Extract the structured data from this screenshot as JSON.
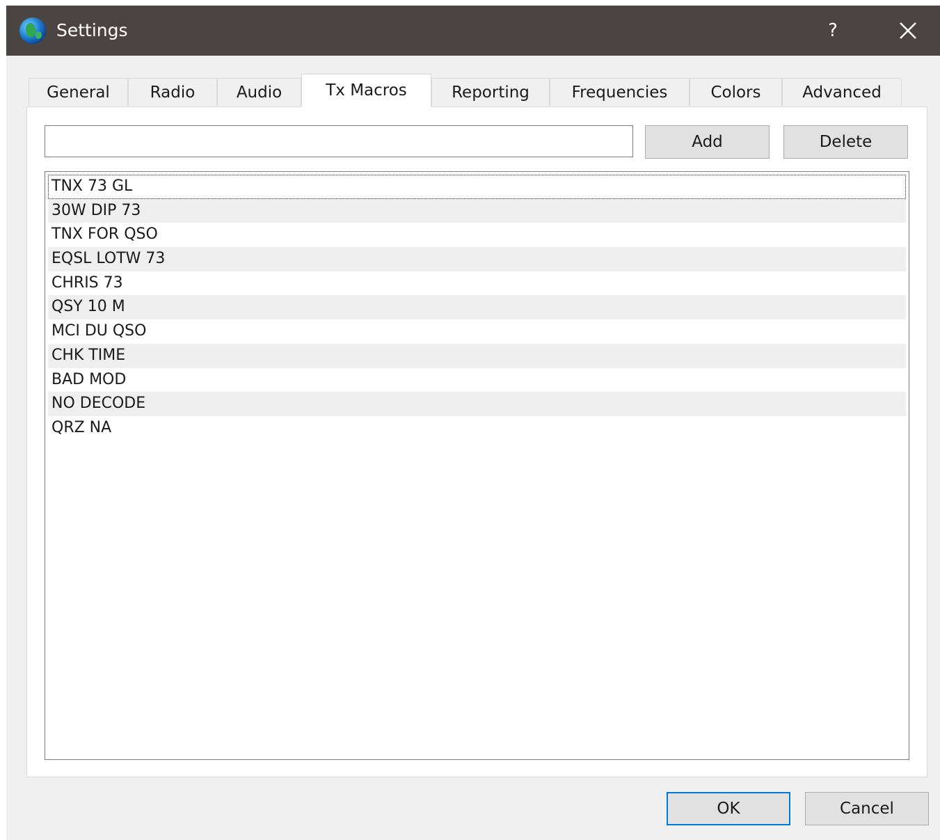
{
  "window": {
    "title": "Settings",
    "help_label": "?",
    "icon": "globe-icon"
  },
  "tabs": [
    {
      "label": "General",
      "active": false
    },
    {
      "label": "Radio",
      "active": false
    },
    {
      "label": "Audio",
      "active": false
    },
    {
      "label": "Tx Macros",
      "active": true
    },
    {
      "label": "Reporting",
      "active": false
    },
    {
      "label": "Frequencies",
      "active": false
    },
    {
      "label": "Colors",
      "active": false
    },
    {
      "label": "Advanced",
      "active": false
    }
  ],
  "macros": {
    "input_value": "",
    "add_label": "Add",
    "delete_label": "Delete",
    "items": [
      "TNX 73 GL",
      "30W DIP 73",
      "TNX FOR QSO",
      "EQSL LOTW 73",
      "CHRIS 73",
      "QSY 10 M",
      "MCI DU QSO",
      "CHK TIME",
      "BAD MOD",
      "NO DECODE",
      "QRZ NA"
    ]
  },
  "footer": {
    "ok_label": "OK",
    "cancel_label": "Cancel"
  },
  "colors": {
    "titlebar": "#4a4543",
    "focus_border": "#0078d7",
    "dialog_bg": "#f0f0f0"
  }
}
